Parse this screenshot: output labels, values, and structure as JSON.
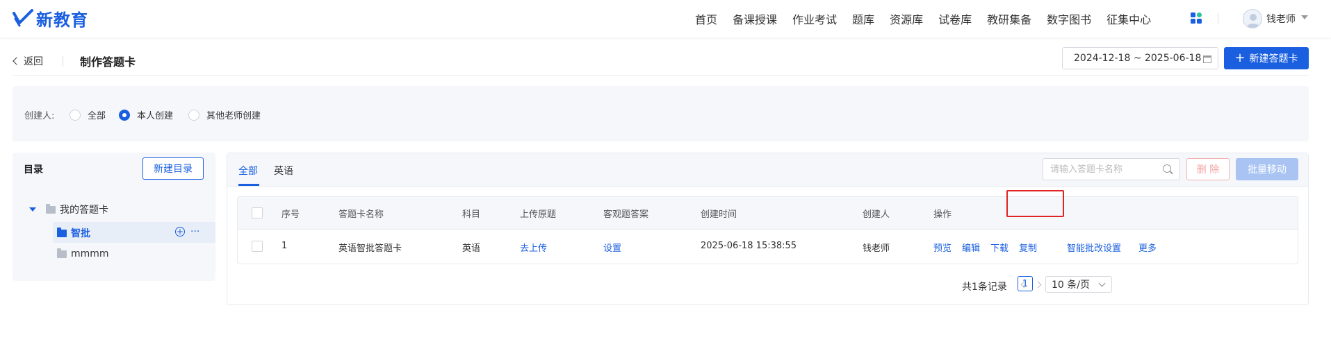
{
  "header": {
    "logo_text": "新教育",
    "nav": [
      "首页",
      "备课授课",
      "作业考试",
      "题库",
      "资源库",
      "试卷库",
      "教研集备",
      "数字图书",
      "征集中心"
    ],
    "user_name": "钱老师"
  },
  "subheader": {
    "back_label": "返回",
    "page_title": "制作答题卡",
    "date_range": "2024-12-18 ~ 2025-06-18",
    "new_card_label": "新建答题卡"
  },
  "filter": {
    "label": "创建人:",
    "options": [
      "全部",
      "本人创建",
      "其他老师创建"
    ],
    "selected": "本人创建"
  },
  "directory": {
    "title": "目录",
    "new_dir_label": "新建目录",
    "root": "我的答题卡",
    "children": [
      "智批",
      "mmmm"
    ],
    "selected": "智批",
    "more_label": "···"
  },
  "main": {
    "tabs": [
      "全部",
      "英语"
    ],
    "active_tab": "全部",
    "search_placeholder": "请输入答题卡名称",
    "delete_label": "删 除",
    "batch_move_label": "批量移动",
    "columns": [
      "序号",
      "答题卡名称",
      "科目",
      "上传原题",
      "客观题答案",
      "创建时间",
      "创建人",
      "操作"
    ],
    "rows": [
      {
        "index": "1",
        "name": "英语智批答题卡",
        "subject": "英语",
        "upload": "去上传",
        "answer": "设置",
        "created": "2025-06-18 15:38:55",
        "creator": "钱老师",
        "actions": [
          "预览",
          "编辑",
          "下载",
          "复制",
          "智能批改设置",
          "更多"
        ]
      }
    ],
    "pagination": {
      "total_text": "共1条记录",
      "current_page": "1",
      "page_size": "10 条/页"
    }
  },
  "colors": {
    "primary": "#1a5fe0",
    "highlight": "#e02424",
    "panel_bg": "#f5f7fb"
  }
}
